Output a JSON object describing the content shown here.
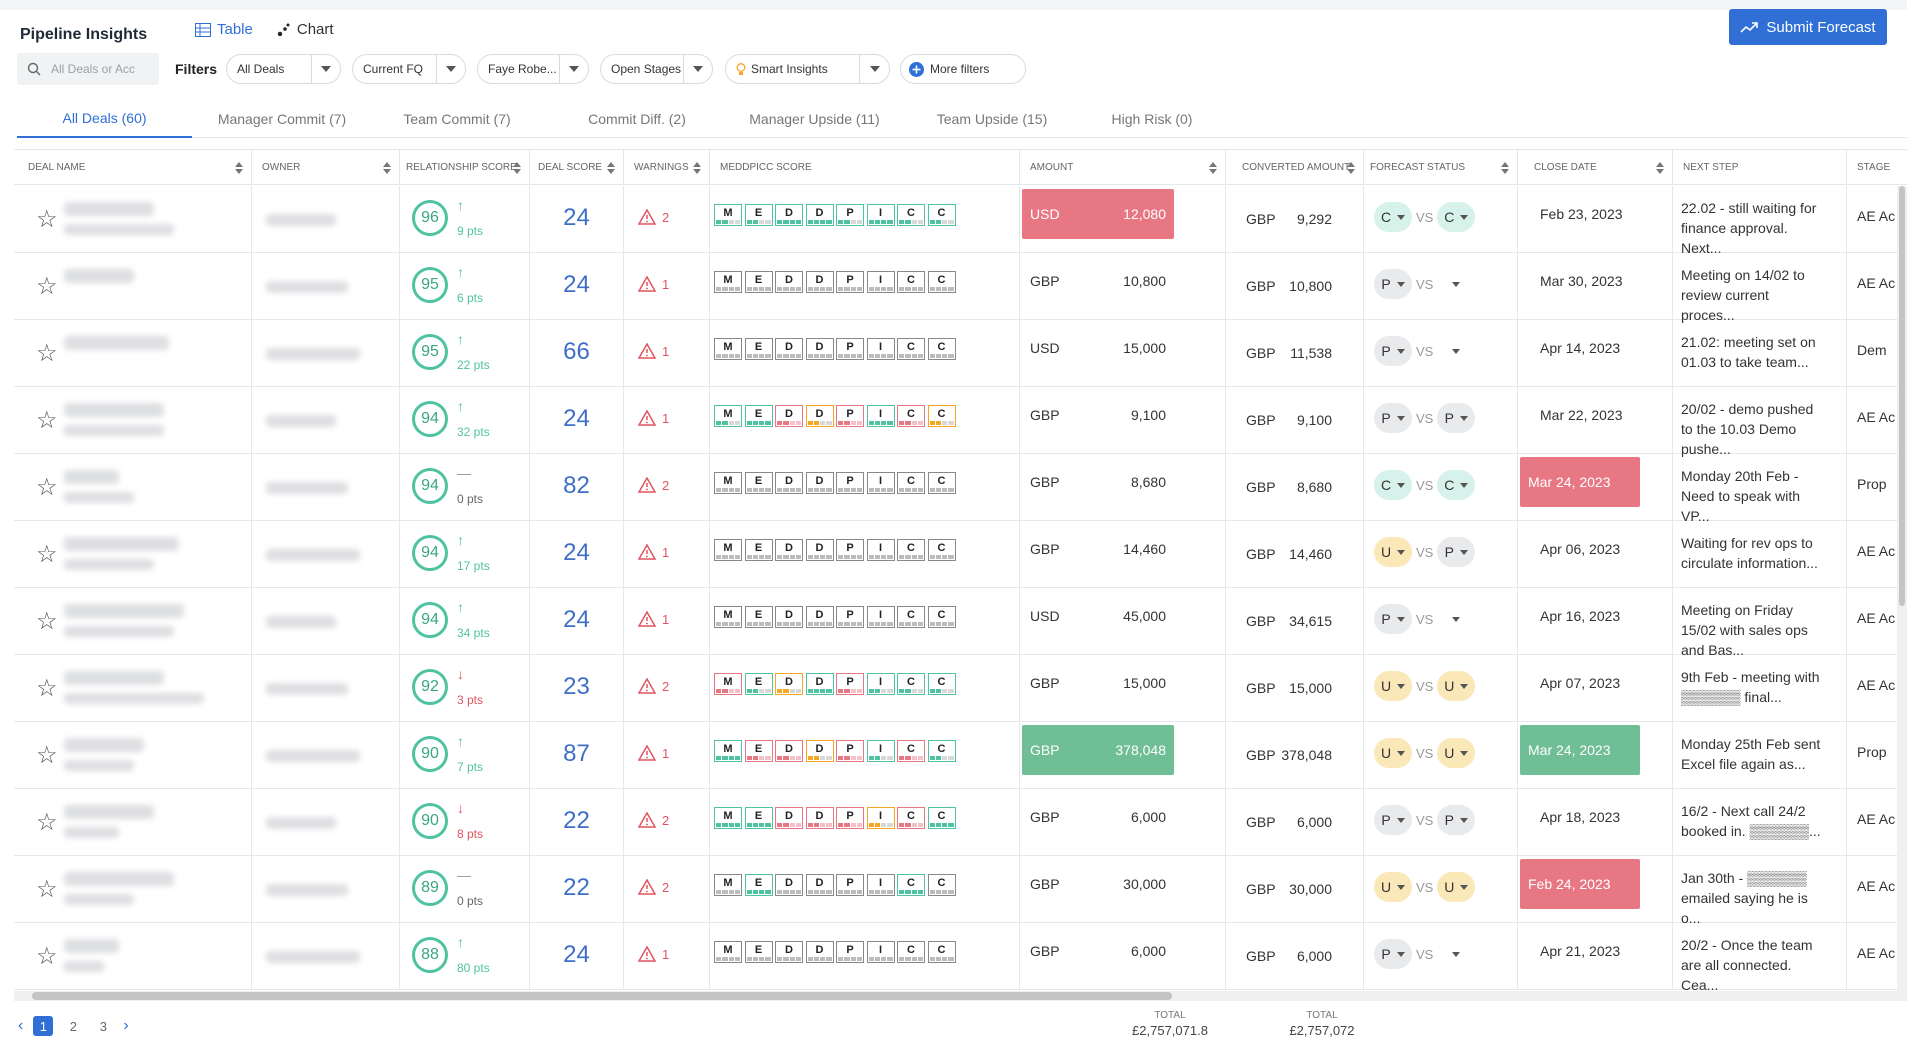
{
  "app": {
    "title": "Pipeline Insights"
  },
  "view_tabs": [
    {
      "label": "Table",
      "icon": "table-icon",
      "active": true
    },
    {
      "label": "Chart",
      "icon": "scatter-chart-icon",
      "active": false
    }
  ],
  "submit_label": "Submit Forecast",
  "search": {
    "placeholder": "All Deals or Acc"
  },
  "filters": {
    "label": "Filters",
    "items": [
      {
        "label": "All Deals"
      },
      {
        "label": "Current FQ"
      },
      {
        "label": "Faye Robe..."
      },
      {
        "label": "Open Stages"
      },
      {
        "label": "Smart Insights",
        "icon": "lightbulb-icon"
      }
    ],
    "more": "More filters"
  },
  "subtabs": [
    "All Deals (60)",
    "Manager Commit (7)",
    "Team Commit (7)",
    "Commit Diff. (2)",
    "Manager Upside (11)",
    "Team Upside (15)",
    "High Risk (0)"
  ],
  "columns": [
    "Deal Name",
    "Owner",
    "Relationship Score",
    "Deal Score",
    "Warnings",
    "MEDDPICC Score",
    "Amount",
    "Converted Amount",
    "Forecast Status",
    "Close Date",
    "Next Step",
    "Stage"
  ],
  "meddpicc_letters": [
    "M",
    "E",
    "D",
    "D",
    "P",
    "I",
    "C",
    "C"
  ],
  "vs_label": "VS",
  "colors": {
    "accent": "#2f6fd6",
    "good": "#4fc3a1",
    "bad": "#e0545f",
    "amount_red": "#e87784",
    "amount_green": "#6fbe95",
    "gray": "#bcbcbc",
    "orange": "#f5a623"
  },
  "rows": [
    {
      "rel": "96",
      "trend": "up",
      "pts": "9 pts",
      "deal": "24",
      "warn": "2",
      "amount_cur": "USD",
      "amount": "12,080",
      "amount_hl": "red",
      "conv_cur": "GBP",
      "conv": "9,292",
      "fc_a": "C",
      "fc_a_c": "t",
      "fc_b": "C",
      "fc_b_c": "t",
      "close": "Feb 23, 2023",
      "close_hl": "",
      "next": "22.02 - still waiting for finance approval. Next...",
      "stage": "AE Ac",
      "med": [
        "g",
        "g",
        "gg",
        "gg",
        "g",
        "gg",
        "g",
        "g"
      ]
    },
    {
      "rel": "95",
      "trend": "up",
      "pts": "6 pts",
      "deal": "24",
      "warn": "1",
      "amount_cur": "GBP",
      "amount": "10,800",
      "amount_hl": "",
      "conv_cur": "GBP",
      "conv": "10,800",
      "fc_a": "P",
      "fc_a_c": "g",
      "fc_b": "",
      "fc_b_c": "e",
      "close": "Mar 30, 2023",
      "close_hl": "",
      "next": "Meeting on 14/02 to review current proces...",
      "stage": "AE Ac",
      "med": [
        "n",
        "n",
        "n",
        "n",
        "n",
        "n",
        "n",
        "n"
      ]
    },
    {
      "rel": "95",
      "trend": "up",
      "pts": "22 pts",
      "deal": "66",
      "warn": "1",
      "amount_cur": "USD",
      "amount": "15,000",
      "amount_hl": "",
      "conv_cur": "GBP",
      "conv": "11,538",
      "fc_a": "P",
      "fc_a_c": "g",
      "fc_b": "",
      "fc_b_c": "e",
      "close": "Apr 14, 2023",
      "close_hl": "",
      "next": "21.02: meeting set on 01.03 to take team...",
      "stage": "Dem",
      "med": [
        "n",
        "n",
        "n",
        "n",
        "n",
        "n",
        "n",
        "n"
      ]
    },
    {
      "rel": "94",
      "trend": "up",
      "pts": "32 pts",
      "deal": "24",
      "warn": "1",
      "amount_cur": "GBP",
      "amount": "9,100",
      "amount_hl": "",
      "conv_cur": "GBP",
      "conv": "9,100",
      "fc_a": "P",
      "fc_a_c": "g",
      "fc_b": "P",
      "fc_b_c": "g",
      "close": "Mar 22, 2023",
      "close_hl": "",
      "next": "20/02 - demo pushed to the 10.03 Demo pushe...",
      "stage": "AE Ac",
      "med": [
        "g",
        "gg",
        "r",
        "o",
        "r",
        "gg",
        "r",
        "o"
      ]
    },
    {
      "rel": "94",
      "trend": "flat",
      "pts": "0 pts",
      "deal": "82",
      "warn": "2",
      "amount_cur": "GBP",
      "amount": "8,680",
      "amount_hl": "",
      "conv_cur": "GBP",
      "conv": "8,680",
      "fc_a": "C",
      "fc_a_c": "t",
      "fc_b": "C",
      "fc_b_c": "t",
      "close": "Mar 24, 2023",
      "close_hl": "red",
      "next": "Monday 20th Feb - Need to speak with VP...",
      "stage": "Prop",
      "med": [
        "n",
        "n",
        "n",
        "n",
        "n",
        "n",
        "n",
        "n"
      ]
    },
    {
      "rel": "94",
      "trend": "up",
      "pts": "17 pts",
      "deal": "24",
      "warn": "1",
      "amount_cur": "GBP",
      "amount": "14,460",
      "amount_hl": "",
      "conv_cur": "GBP",
      "conv": "14,460",
      "fc_a": "U",
      "fc_a_c": "y",
      "fc_b": "P",
      "fc_b_c": "g",
      "close": "Apr 06, 2023",
      "close_hl": "",
      "next": "Waiting for rev ops to circulate information...",
      "stage": "AE Ac",
      "med": [
        "n",
        "n",
        "n",
        "n",
        "n",
        "n",
        "n",
        "n"
      ]
    },
    {
      "rel": "94",
      "trend": "up",
      "pts": "34 pts",
      "deal": "24",
      "warn": "1",
      "amount_cur": "USD",
      "amount": "45,000",
      "amount_hl": "",
      "conv_cur": "GBP",
      "conv": "34,615",
      "fc_a": "P",
      "fc_a_c": "g",
      "fc_b": "",
      "fc_b_c": "e",
      "close": "Apr 16, 2023",
      "close_hl": "",
      "next": "Meeting on Friday 15/02 with sales ops and Bas...",
      "stage": "AE Ac",
      "med": [
        "n",
        "n",
        "n",
        "n",
        "n",
        "n",
        "n",
        "n"
      ]
    },
    {
      "rel": "92",
      "trend": "down",
      "pts": "3 pts",
      "deal": "23",
      "warn": "2",
      "amount_cur": "GBP",
      "amount": "15,000",
      "amount_hl": "",
      "conv_cur": "GBP",
      "conv": "15,000",
      "fc_a": "U",
      "fc_a_c": "y",
      "fc_b": "U",
      "fc_b_c": "y",
      "close": "Apr 07, 2023",
      "close_hl": "",
      "next": "9th Feb - meeting with ▒▒▒▒▒▒ final...",
      "stage": "AE Ac",
      "med": [
        "r",
        "g",
        "o",
        "gg",
        "r",
        "g",
        "g",
        "g"
      ]
    },
    {
      "rel": "90",
      "trend": "up",
      "pts": "7 pts",
      "deal": "87",
      "warn": "1",
      "amount_cur": "GBP",
      "amount": "378,048",
      "amount_hl": "green",
      "conv_cur": "GBP",
      "conv": "378,048",
      "fc_a": "U",
      "fc_a_c": "y",
      "fc_b": "U",
      "fc_b_c": "y",
      "close": "Mar 24, 2023",
      "close_hl": "green",
      "next": "Monday 25th Feb sent Excel file again as...",
      "stage": "Prop",
      "med": [
        "gg",
        "r",
        "r",
        "o",
        "r",
        "g",
        "r",
        "g"
      ]
    },
    {
      "rel": "90",
      "trend": "down",
      "pts": "8 pts",
      "deal": "22",
      "warn": "2",
      "amount_cur": "GBP",
      "amount": "6,000",
      "amount_hl": "",
      "conv_cur": "GBP",
      "conv": "6,000",
      "fc_a": "P",
      "fc_a_c": "g",
      "fc_b": "P",
      "fc_b_c": "g",
      "close": "Apr 18, 2023",
      "close_hl": "",
      "next": "16/2 - Next call 24/2 booked in. ▒▒▒▒▒▒...",
      "stage": "AE Ac",
      "med": [
        "gg",
        "gg",
        "r",
        "r",
        "r",
        "o",
        "r",
        "gg"
      ]
    },
    {
      "rel": "89",
      "trend": "flat",
      "pts": "0 pts",
      "deal": "22",
      "warn": "2",
      "amount_cur": "GBP",
      "amount": "30,000",
      "amount_hl": "",
      "conv_cur": "GBP",
      "conv": "30,000",
      "fc_a": "U",
      "fc_a_c": "y",
      "fc_b": "U",
      "fc_b_c": "y",
      "close": "Feb 24, 2023",
      "close_hl": "red",
      "next": "Jan 30th - ▒▒▒▒▒▒ emailed saying he is o...",
      "stage": "AE Ac",
      "med": [
        "n",
        "gg",
        "n",
        "n",
        "n",
        "n",
        "gg",
        "n"
      ]
    },
    {
      "rel": "88",
      "trend": "up",
      "pts": "80 pts",
      "deal": "24",
      "warn": "1",
      "amount_cur": "GBP",
      "amount": "6,000",
      "amount_hl": "",
      "conv_cur": "GBP",
      "conv": "6,000",
      "fc_a": "P",
      "fc_a_c": "g",
      "fc_b": "",
      "fc_b_c": "e",
      "close": "Apr 21, 2023",
      "close_hl": "",
      "next": "20/2 - Once the team are all connected. Cea...",
      "stage": "AE Ac",
      "med": [
        "n",
        "n",
        "n",
        "n",
        "n",
        "n",
        "n",
        "n"
      ]
    }
  ],
  "pagination": {
    "pages": [
      "1",
      "2",
      "3"
    ],
    "active": "1"
  },
  "totals": [
    {
      "label": "TOTAL",
      "value": "£2,757,071.8"
    },
    {
      "label": "TOTAL",
      "value": "£2,757,072"
    }
  ]
}
